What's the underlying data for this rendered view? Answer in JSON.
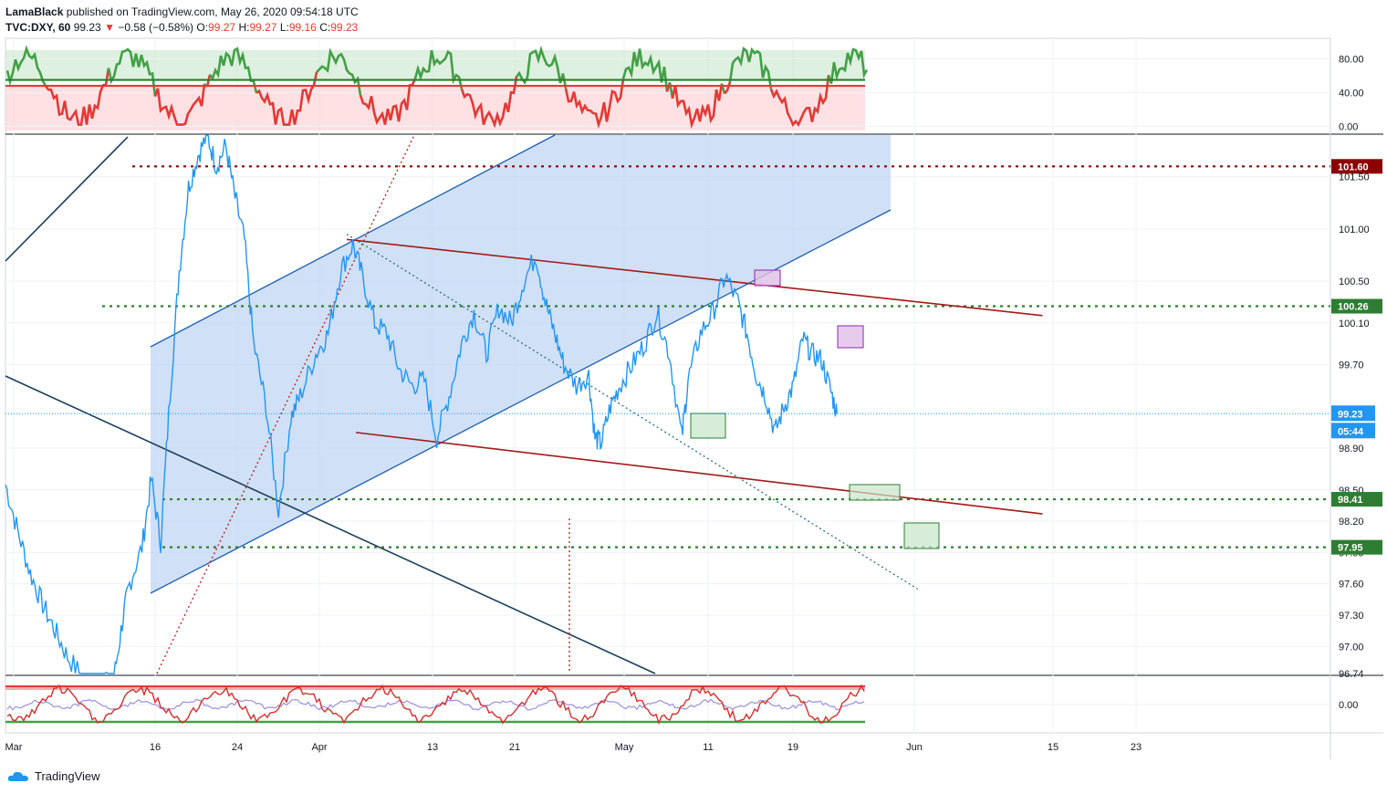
{
  "header": {
    "author": "LamaBlack",
    "published_text": "published on TradingView.com, May 26, 2020 09:54:18 UTC",
    "symbol": "TVC:DXY, 60",
    "last": "99.23",
    "change": "−0.58 (−0.58%)",
    "o_label": "O:",
    "o_value": "99.27",
    "h_label": "H:",
    "h_value": "99.27",
    "l_label": "L:",
    "l_value": "99.16",
    "c_label": "C:",
    "c_value": "99.23"
  },
  "footer": {
    "brand": "TradingView"
  },
  "colors": {
    "price": "#2196f3",
    "channel_fill": "#b7cff3",
    "support": "#2e7d32",
    "resistance": "#8b0000",
    "tag_green": "#2e7d32",
    "tag_red": "#8b0000",
    "tag_blue": "#2196f3"
  },
  "chart_data": [
    {
      "type": "line",
      "name": "main",
      "x_ticks": [
        "Mar",
        "16",
        "24",
        "Apr",
        "13",
        "21",
        "May",
        "11",
        "19",
        "Jun",
        "15",
        "23"
      ],
      "y_ticks": [
        "101.50",
        "101.00",
        "100.50",
        "100.10",
        "99.70",
        "98.90",
        "98.50",
        "98.20",
        "97.90",
        "97.60",
        "97.30",
        "97.00",
        "96.74"
      ],
      "ylim": [
        96.74,
        101.9
      ],
      "price_series": [
        [
          0,
          98.55
        ],
        [
          0.04,
          98.1
        ],
        [
          0.08,
          97.7
        ],
        [
          0.12,
          97.4
        ],
        [
          0.16,
          97.15
        ],
        [
          0.2,
          96.9
        ],
        [
          0.25,
          96.7
        ],
        [
          0.3,
          96.6
        ],
        [
          0.35,
          96.7
        ],
        [
          0.38,
          97.3
        ],
        [
          0.4,
          97.6
        ],
        [
          0.44,
          97.95
        ],
        [
          0.47,
          98.6
        ],
        [
          0.5,
          98.0
        ],
        [
          0.53,
          99.4
        ],
        [
          0.56,
          100.6
        ],
        [
          0.59,
          101.4
        ],
        [
          0.62,
          101.7
        ],
        [
          0.65,
          101.9
        ],
        [
          0.68,
          101.6
        ],
        [
          0.71,
          101.8
        ],
        [
          0.74,
          101.3
        ],
        [
          0.77,
          100.9
        ],
        [
          0.8,
          99.9
        ],
        [
          0.84,
          99.3
        ],
        [
          0.88,
          98.3
        ],
        [
          0.92,
          99.2
        ],
        [
          0.95,
          99.4
        ],
        [
          1.0,
          99.8
        ],
        [
          1.04,
          100.0
        ],
        [
          1.08,
          100.6
        ],
        [
          1.12,
          100.85
        ],
        [
          1.15,
          100.55
        ],
        [
          1.19,
          100.1
        ],
        [
          1.23,
          100.0
        ],
        [
          1.27,
          99.65
        ],
        [
          1.31,
          99.5
        ],
        [
          1.35,
          99.55
        ],
        [
          1.39,
          99.0
        ],
        [
          1.43,
          99.4
        ],
        [
          1.47,
          99.9
        ],
        [
          1.51,
          100.2
        ],
        [
          1.55,
          99.8
        ],
        [
          1.59,
          100.25
        ],
        [
          1.63,
          100.1
        ],
        [
          1.67,
          100.5
        ],
        [
          1.71,
          100.75
        ],
        [
          1.74,
          100.3
        ],
        [
          1.77,
          100.0
        ],
        [
          1.8,
          99.7
        ],
        [
          1.84,
          99.5
        ],
        [
          1.88,
          99.6
        ],
        [
          1.9,
          99.0
        ],
        [
          1.92,
          98.95
        ],
        [
          1.95,
          99.3
        ],
        [
          1.98,
          99.5
        ],
        [
          2.02,
          99.7
        ],
        [
          2.06,
          99.9
        ],
        [
          2.1,
          100.2
        ],
        [
          2.14,
          99.8
        ],
        [
          2.18,
          99.0
        ],
        [
          2.2,
          99.55
        ],
        [
          2.24,
          100.0
        ],
        [
          2.28,
          100.2
        ],
        [
          2.32,
          100.55
        ],
        [
          2.36,
          100.3
        ],
        [
          2.39,
          100.0
        ],
        [
          2.42,
          99.6
        ],
        [
          2.45,
          99.4
        ],
        [
          2.48,
          99.05
        ],
        [
          2.51,
          99.3
        ],
        [
          2.54,
          99.5
        ],
        [
          2.57,
          99.95
        ],
        [
          2.6,
          99.8
        ],
        [
          2.63,
          99.75
        ],
        [
          2.66,
          99.45
        ],
        [
          2.68,
          99.23
        ]
      ],
      "series": [
        {
          "name": "upper-resistance",
          "x": [
            1.1,
            2.96
          ],
          "y": [
            100.9,
            100.17
          ]
        },
        {
          "name": "lower-support",
          "x": [
            1.1,
            2.96
          ],
          "y": [
            99.05,
            98.27
          ]
        },
        {
          "name": "dotted-downtrend",
          "x": [
            1.1,
            2.94
          ],
          "y": [
            100.95,
            97.55
          ]
        }
      ],
      "horizontal_levels": [
        {
          "label": "101.60",
          "value": 101.6,
          "color": "#8b0000"
        },
        {
          "label": "100.26",
          "value": 100.26,
          "color": "#2e7d32"
        },
        {
          "label": "98.41",
          "value": 98.41,
          "color": "#2e7d32"
        },
        {
          "label": "97.95",
          "value": 97.95,
          "color": "#2e7d32"
        }
      ],
      "price_tag": {
        "label": "99.23",
        "value": 99.23
      },
      "countdown": {
        "label": "05:44"
      }
    },
    {
      "type": "line",
      "name": "upper-oscillator",
      "y_ticks": [
        "80.00",
        "40.00",
        "0.00"
      ],
      "ylim": [
        -5,
        100
      ],
      "levels": [
        48,
        55
      ]
    },
    {
      "type": "line",
      "name": "lower-oscillator",
      "y_ticks": [
        "0.00"
      ]
    }
  ]
}
